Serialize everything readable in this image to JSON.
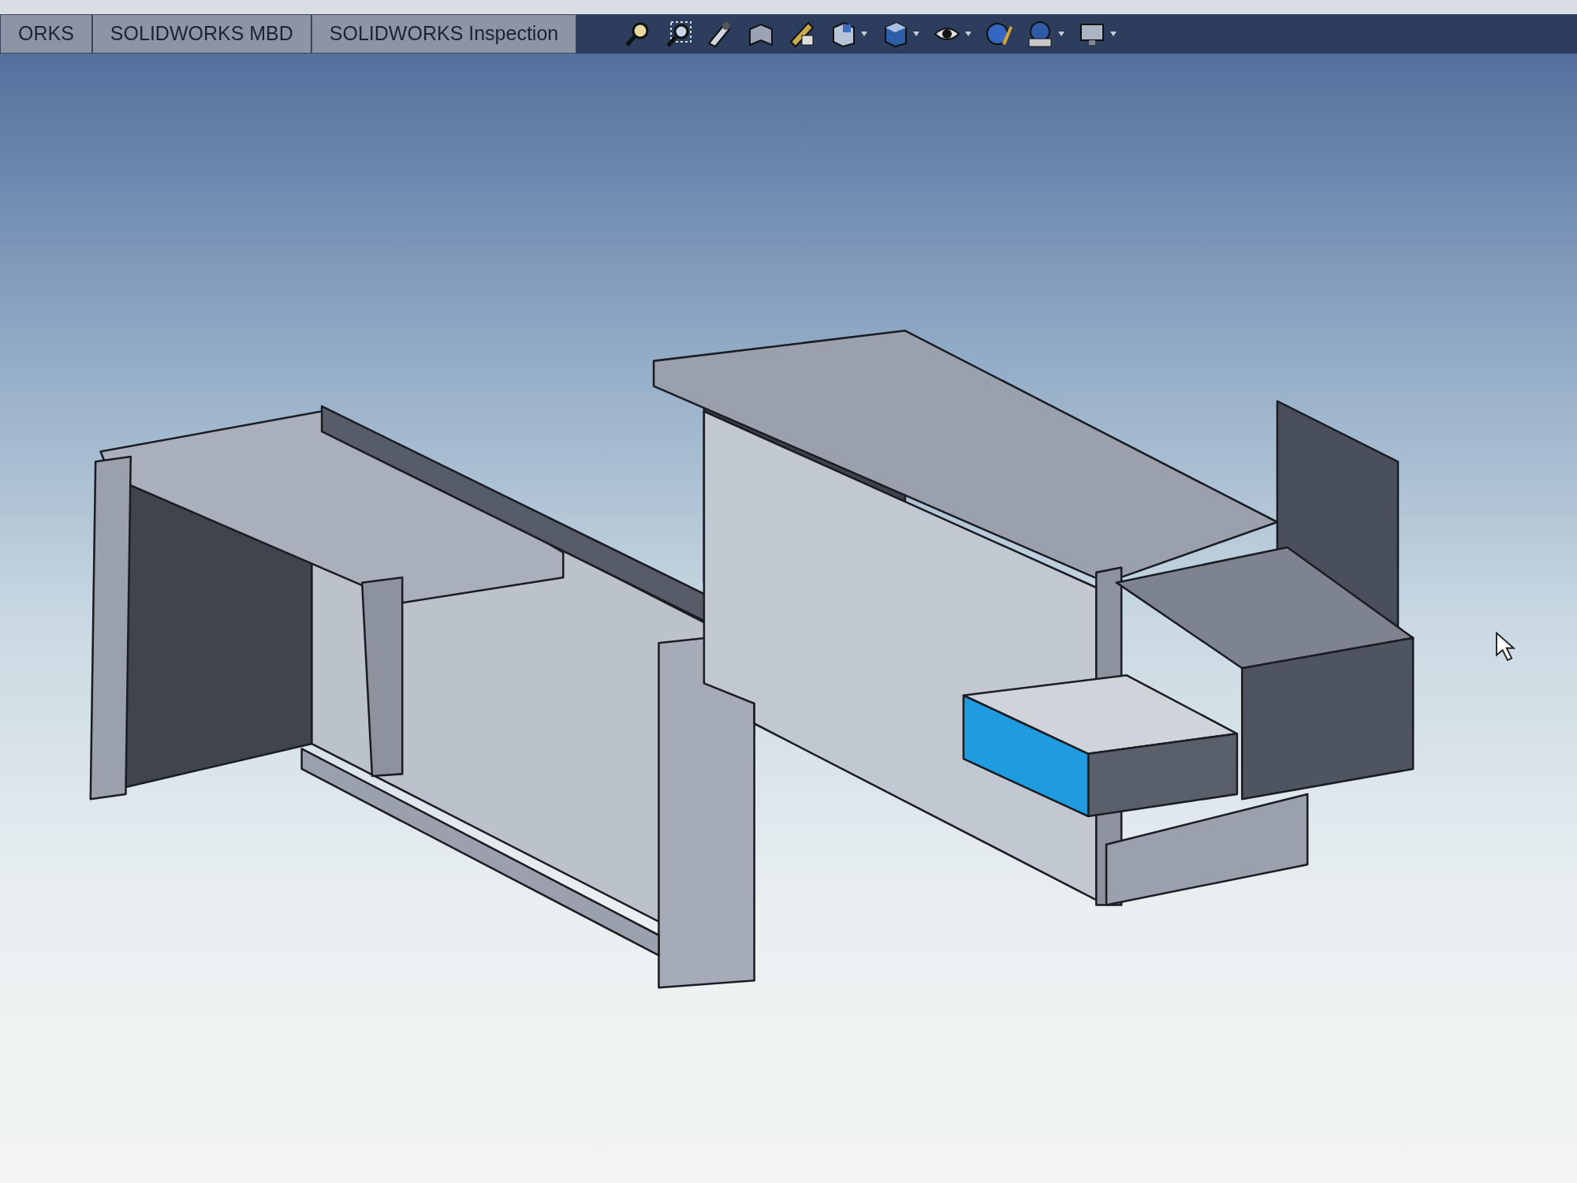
{
  "tabs": [
    {
      "label": "ORKS"
    },
    {
      "label": "SOLIDWORKS MBD"
    },
    {
      "label": "SOLIDWORKS Inspection"
    }
  ],
  "toolbar": [
    {
      "kind": "magnifier",
      "dropdown": false
    },
    {
      "kind": "magnifier-box",
      "dropdown": false
    },
    {
      "kind": "pointer",
      "dropdown": false
    },
    {
      "kind": "section",
      "dropdown": false
    },
    {
      "kind": "annotation",
      "dropdown": false
    },
    {
      "kind": "cube-view",
      "dropdown": true
    },
    {
      "kind": "cube",
      "dropdown": true
    },
    {
      "kind": "eye",
      "dropdown": true
    },
    {
      "kind": "sphere",
      "dropdown": false
    },
    {
      "kind": "scene",
      "dropdown": true
    },
    {
      "kind": "monitor",
      "dropdown": true
    }
  ]
}
